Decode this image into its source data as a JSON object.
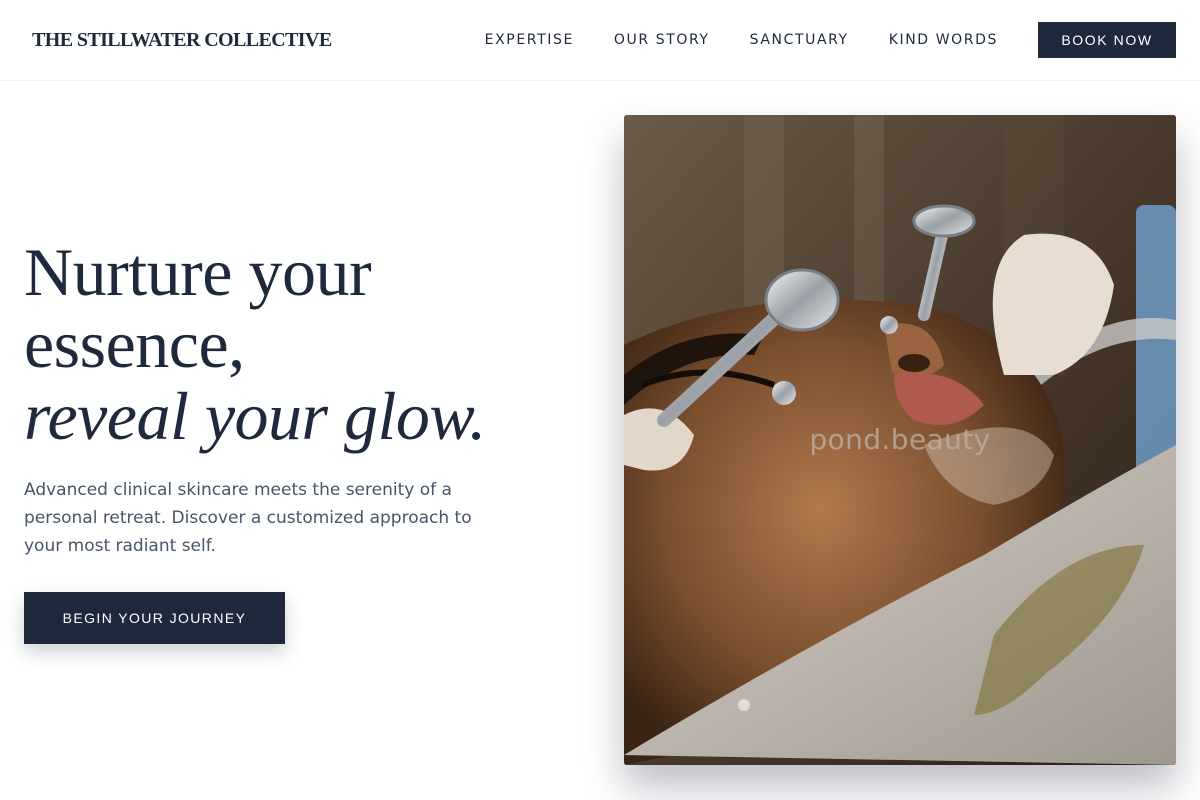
{
  "header": {
    "brand": "THE STILLWATER COLLECTIVE",
    "nav": [
      {
        "label": "EXPERTISE"
      },
      {
        "label": "OUR STORY"
      },
      {
        "label": "SANCTUARY"
      },
      {
        "label": "KIND WORDS"
      }
    ],
    "cta_label": "BOOK NOW"
  },
  "hero": {
    "title_line1": "Nurture your",
    "title_line2": "essence,",
    "title_line3": "reveal your glow.",
    "subtitle": "Advanced clinical skincare meets the serenity of a personal retreat. Discover a customized approach to your most radiant self.",
    "cta_label": "BEGIN YOUR JOURNEY"
  },
  "photo": {
    "watermark": "pond.beauty"
  },
  "colors": {
    "navy": "#1e293b",
    "body_text": "#475569",
    "background": "#ffffff"
  }
}
